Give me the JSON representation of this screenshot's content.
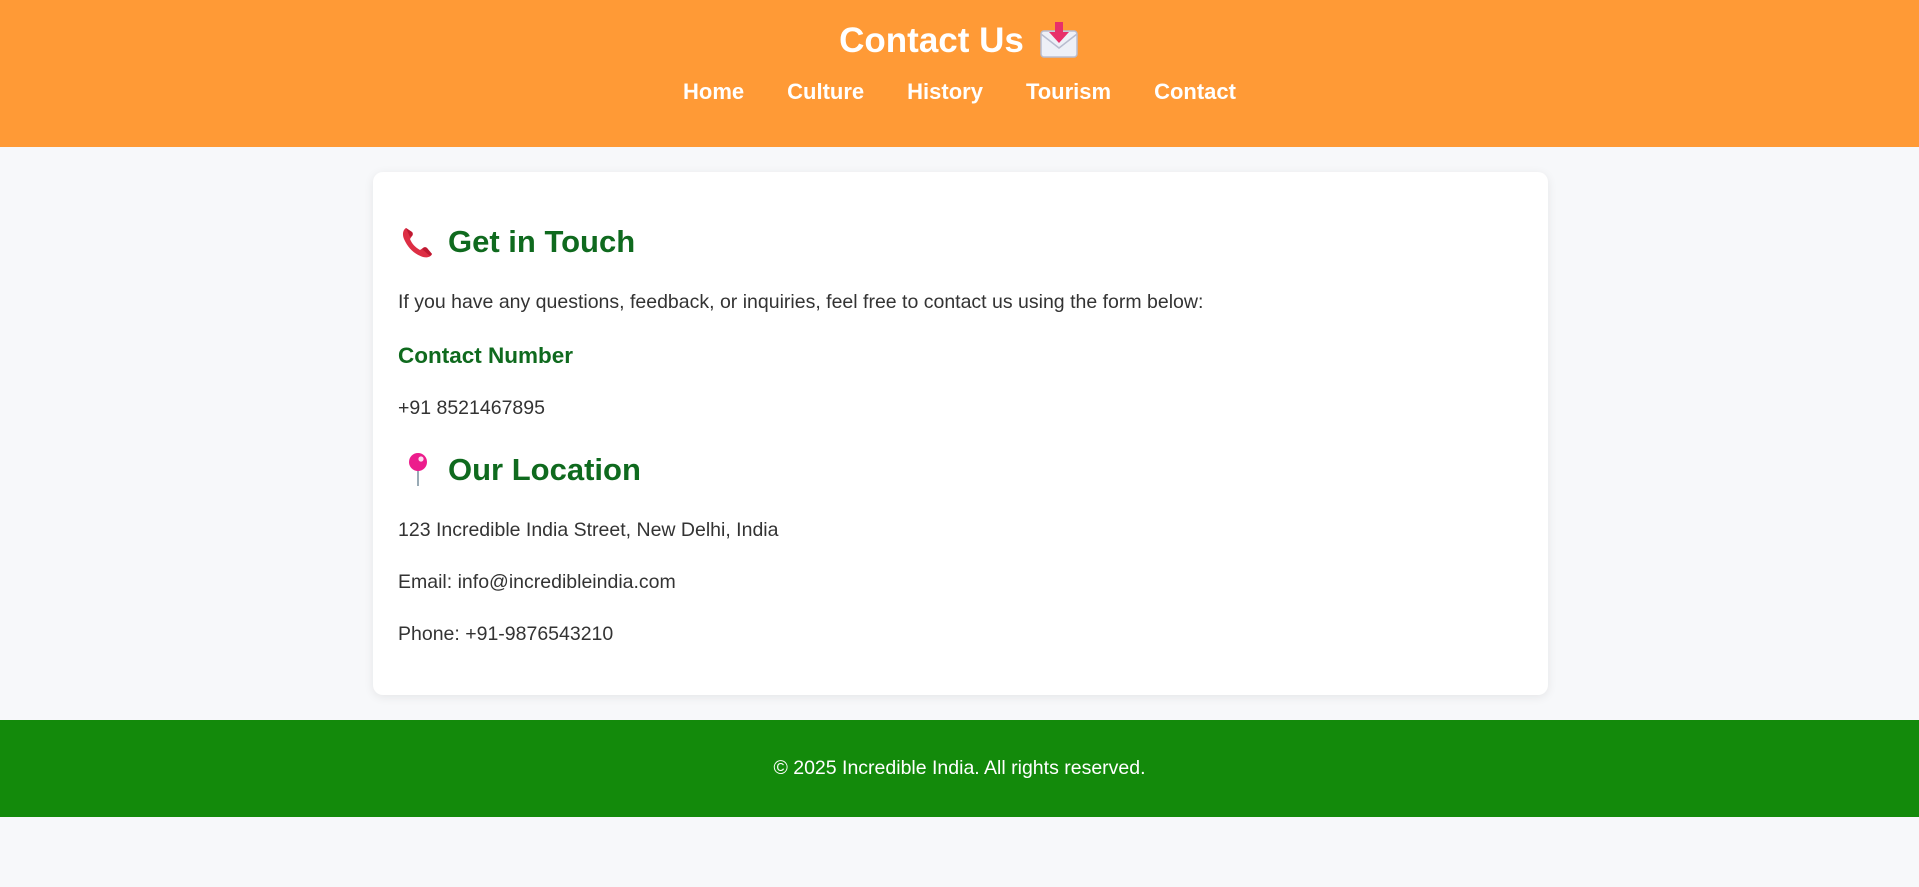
{
  "header": {
    "title": "Contact Us",
    "title_icon": "inbox-tray-envelope-icon",
    "background_color": "#ff9a36"
  },
  "nav": {
    "items": [
      {
        "label": "Home"
      },
      {
        "label": "Culture"
      },
      {
        "label": "History"
      },
      {
        "label": "Tourism"
      },
      {
        "label": "Contact"
      }
    ]
  },
  "main": {
    "get_in_touch": {
      "heading": "Get in Touch",
      "icon": "telephone-receiver-icon",
      "intro": "If you have any questions, feedback, or inquiries, feel free to contact us using the form below:"
    },
    "contact_number": {
      "heading": "Contact Number",
      "value": "+91 8521467895"
    },
    "location": {
      "heading": "Our Location",
      "icon": "round-pushpin-icon",
      "address": "123 Incredible India Street, New Delhi, India",
      "email": "Email: info@incredibleindia.com",
      "phone": "Phone: +91-9876543210"
    },
    "heading_color": "#0f6a1e"
  },
  "footer": {
    "text": "© 2025 Incredible India. All rights reserved.",
    "background_color": "#138a0b"
  }
}
